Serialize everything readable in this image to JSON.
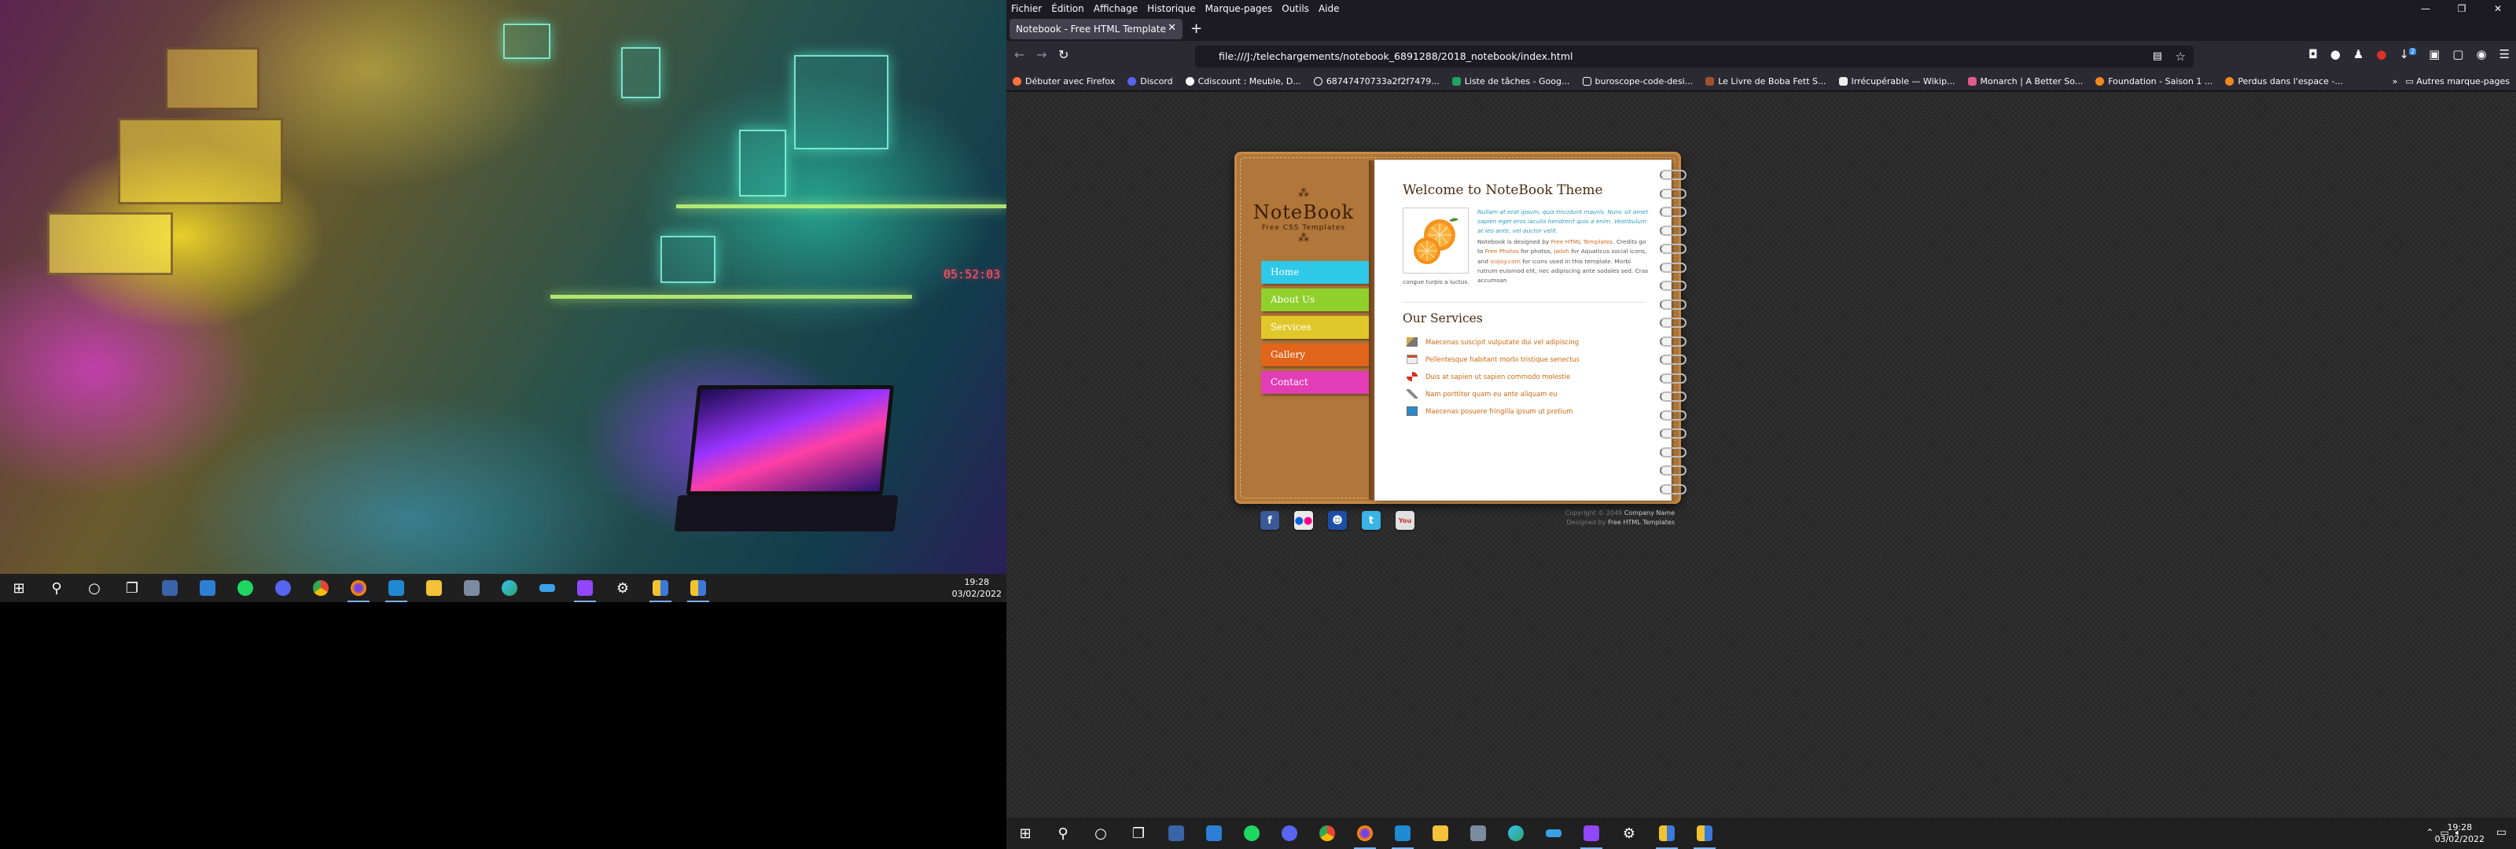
{
  "left_screen": {
    "wallpaper_clock": "05:52:03",
    "taskbar": {
      "icons": [
        "windows-start-icon",
        "search-icon",
        "cortana-icon",
        "task-view-icon",
        "calculator-icon",
        "paint-icon",
        "spotify-icon",
        "discord-icon",
        "chrome-icon",
        "firefox-icon",
        "vscode-icon",
        "file-explorer-icon",
        "camera-icon",
        "edge-icon",
        "monitor-app-icon",
        "twitch-icon",
        "settings-icon",
        "folder-app-icon",
        "folder-app-2-icon"
      ],
      "time": "19:28",
      "date": "03/02/2022"
    }
  },
  "browser": {
    "menu": [
      "Fichier",
      "Édition",
      "Affichage",
      "Historique",
      "Marque-pages",
      "Outils",
      "Aide"
    ],
    "tab_title": "Notebook - Free HTML Template",
    "url": "file:///J:/telechargements/notebook_6891288/2018_notebook/index.html",
    "bookmarks": [
      "Débuter avec Firefox",
      "Discord",
      "Cdiscount : Meuble, D...",
      "68747470733a2f2f7479...",
      "Liste de tâches - Goog...",
      "buroscope-code-desi...",
      "Le Livre de Boba Fett S...",
      "Irrécupérable — Wikip...",
      "Monarch | A Better So...",
      "Foundation - Saison 1 ...",
      "Perdus dans l'espace -..."
    ],
    "bookmarks_more": "Autres marque-pages",
    "badge_count": "2"
  },
  "site": {
    "logo_name": "NoteBook",
    "logo_tagline": "Free CSS Templates",
    "nav": [
      {
        "label": "Home",
        "color": "#2ec8e8"
      },
      {
        "label": "About Us",
        "color": "#8fd02b"
      },
      {
        "label": "Services",
        "color": "#e0c82a"
      },
      {
        "label": "Gallery",
        "color": "#e0641a"
      },
      {
        "label": "Contact",
        "color": "#e23db6"
      }
    ],
    "title": "Welcome to NoteBook Theme",
    "intro": "Nullam at erat ipsum, quis tincidunt mauris. Nunc sit amet sapien eget eros iaculis hendrerit quis a enim. Vestibulum at leo ante, vel auctor velit.",
    "body_parts": {
      "p1": "Notebook is designed by ",
      "link1": "Free HTML Templates",
      "p2": ". Credits go to ",
      "link2": "Free Photos",
      "p3": " for photos, ",
      "link3": "jwloh",
      "p4": " for Aquaticus social icons, and ",
      "link4": "icojoy.com",
      "p5": " for icons used in this template. Morbi rutrum euismod elit, nec adipiscing ante sodales sed. Cras accumsan",
      "p6": "congue turpis a luctus."
    },
    "services_title": "Our Services",
    "services": [
      {
        "text": "Maecenas suscipit vulputate dui vel adipiscing",
        "icon": "tools-icon"
      },
      {
        "text": "Pellentesque habitant morbi tristique senectus",
        "icon": "calendar-icon"
      },
      {
        "text": "Duis at sapien ut sapien commodo molestie",
        "icon": "lifebuoy-icon"
      },
      {
        "text": "Nam porttitor quam eu ante aliquam eu",
        "icon": "pen-icon"
      },
      {
        "text": "Maecenas posuere fringilla ipsum ut pretium",
        "icon": "monitor-icon"
      }
    ],
    "social": [
      {
        "name": "facebook-icon",
        "glyph": "f",
        "color": "#3b5998"
      },
      {
        "name": "flickr-icon",
        "glyph": "●●",
        "color": "#eaeaea"
      },
      {
        "name": "myspace-icon",
        "glyph": "☻",
        "color": "#1d4fa8"
      },
      {
        "name": "twitter-icon",
        "glyph": "t",
        "color": "#39b4e6"
      },
      {
        "name": "youtube-icon",
        "glyph": "You",
        "color": "#e0e0e0"
      }
    ],
    "footer_prefix": "Copyright © 2048 ",
    "footer_company": "Company Name",
    "footer_designed": "Designed by ",
    "footer_designer": "Free HTML Templates"
  },
  "right_taskbar": {
    "time": "19:28",
    "date": "03/02/2022"
  }
}
